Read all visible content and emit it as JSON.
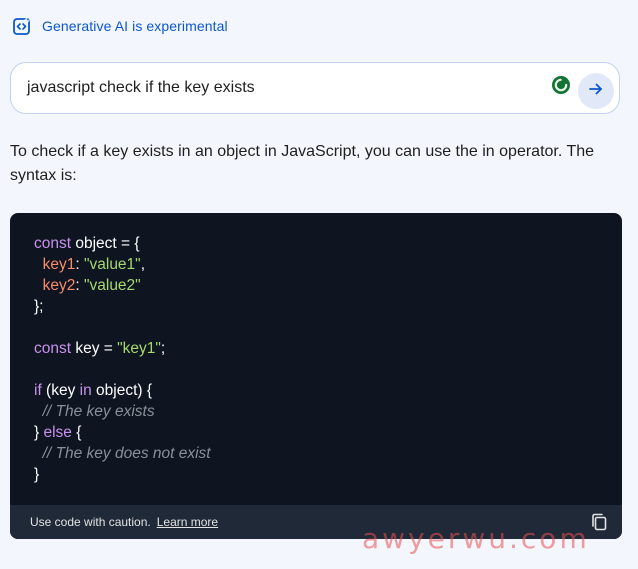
{
  "banner": {
    "icon": "code-sparkle-icon",
    "label": "Generative AI is experimental"
  },
  "search": {
    "query": "javascript check if the key exists",
    "loader_icon": "loading-spinner-icon",
    "send_icon": "arrow-right-icon"
  },
  "answer": {
    "text": "To check if a key exists in an object in JavaScript, you can use the in operator. The syntax is:"
  },
  "code": {
    "lines": [
      [
        {
          "t": "const",
          "c": "kw"
        },
        {
          "t": " object = {",
          "c": ""
        }
      ],
      [
        {
          "t": "  ",
          "c": ""
        },
        {
          "t": "key1",
          "c": "prop"
        },
        {
          "t": ": ",
          "c": ""
        },
        {
          "t": "\"value1\"",
          "c": "str"
        },
        {
          "t": ",",
          "c": ""
        }
      ],
      [
        {
          "t": "  ",
          "c": ""
        },
        {
          "t": "key2",
          "c": "prop"
        },
        {
          "t": ": ",
          "c": ""
        },
        {
          "t": "\"value2\"",
          "c": "str"
        }
      ],
      [
        {
          "t": "};",
          "c": ""
        }
      ],
      [],
      [
        {
          "t": "const",
          "c": "kw"
        },
        {
          "t": " key = ",
          "c": ""
        },
        {
          "t": "\"key1\"",
          "c": "str"
        },
        {
          "t": ";",
          "c": ""
        }
      ],
      [],
      [
        {
          "t": "if",
          "c": "kw"
        },
        {
          "t": " (key ",
          "c": ""
        },
        {
          "t": "in",
          "c": "kw"
        },
        {
          "t": " object) {",
          "c": ""
        }
      ],
      [
        {
          "t": "  // The key exists",
          "c": "cmt"
        }
      ],
      [
        {
          "t": "} ",
          "c": ""
        },
        {
          "t": "else",
          "c": "kw"
        },
        {
          "t": " {",
          "c": ""
        }
      ],
      [
        {
          "t": "  // The key does not exist",
          "c": "cmt"
        }
      ],
      [
        {
          "t": "}",
          "c": ""
        }
      ]
    ],
    "caution": "Use code with caution.",
    "learn_more": "Learn more",
    "copy_icon": "copy-icon"
  },
  "watermark": {
    "text": "awyerwu.com"
  }
}
